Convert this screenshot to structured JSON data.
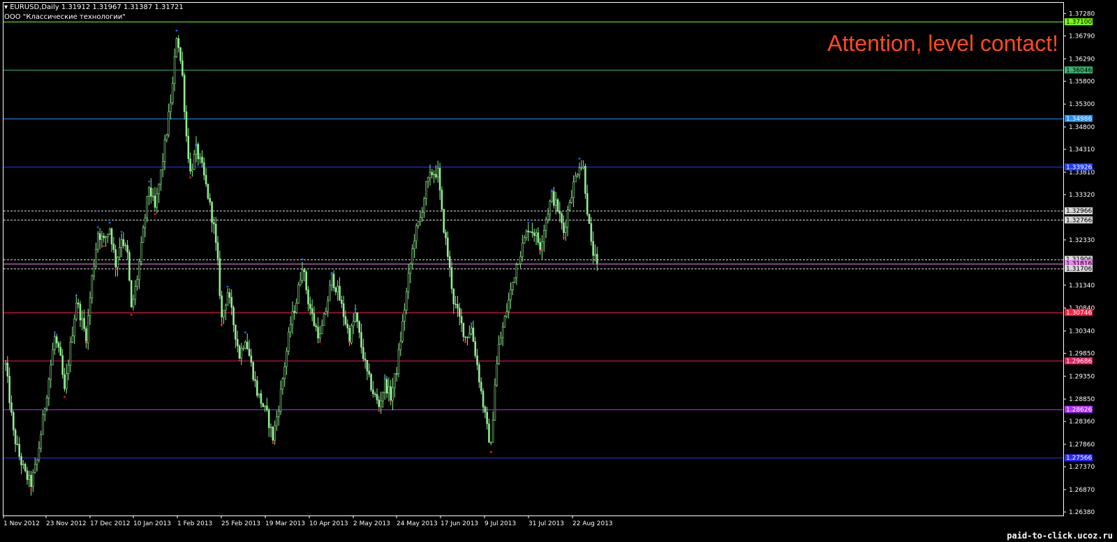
{
  "header": {
    "symbol_line": "EURUSD,Daily  1.31912 1.31967 1.31387 1.31721",
    "indicator_line": "ООО \"Классические технологии\""
  },
  "alert": {
    "text": "Attention, level contact!",
    "color": "#ff4a1a"
  },
  "watermark": "paid-to-click.ucoz.ru",
  "colors": {
    "background": "#000000",
    "candle": "#90ee90",
    "frame": "#ffffff"
  },
  "chart_data": {
    "type": "candlestick",
    "ylim": [
      1.2638,
      1.3753
    ],
    "y_ticks": [
      "1.37280",
      "1.36790",
      "1.36290",
      "1.35800",
      "1.35300",
      "1.34800",
      "1.34310",
      "1.33810",
      "1.33320",
      "1.32330",
      "1.31340",
      "1.30840",
      "1.30340",
      "1.29850",
      "1.29350",
      "1.28850",
      "1.28360",
      "1.27860",
      "1.27370",
      "1.26870",
      "1.26380"
    ],
    "x_labels": [
      "1 Nov 2012",
      "23 Nov 2012",
      "17 Dec 2012",
      "10 Jan 2013",
      "1 Feb 2013",
      "25 Feb 2013",
      "19 Mar 2013",
      "10 Apr 2013",
      "2 May 2013",
      "24 May 2013",
      "17 Jun 2013",
      "9 Jul 2013",
      "31 Jul 2013",
      "22 Aug 2013"
    ],
    "levels": [
      {
        "price": 1.371,
        "label": "1.37100",
        "color": "#7cfc00",
        "style": "solid"
      },
      {
        "price": 1.36046,
        "label": "1.36046",
        "color": "#3cb371",
        "style": "solid"
      },
      {
        "price": 1.34986,
        "label": "1.34986",
        "color": "#1e90ff",
        "style": "solid"
      },
      {
        "price": 1.33926,
        "label": "1.33926",
        "color": "#1f3cff",
        "style": "solid"
      },
      {
        "price": 1.32966,
        "label": "1.32966",
        "color": "#d9d9d9",
        "style": "dashed"
      },
      {
        "price": 1.32766,
        "label": "1.32766",
        "color": "#d9d9d9",
        "style": "dashed"
      },
      {
        "price": 1.31906,
        "label": "1.31906",
        "color": "#d9d9d9",
        "style": "dashed"
      },
      {
        "price": 1.31816,
        "label": "1.31816",
        "color": "#ee82ee",
        "style": "solid"
      },
      {
        "price": 1.31706,
        "label": "1.31706",
        "color": "#d9d9d9",
        "style": "dashed"
      },
      {
        "price": 1.30746,
        "label": "1.30746",
        "color": "#ff1a3c",
        "style": "solid"
      },
      {
        "price": 1.29686,
        "label": "1.29686",
        "color": "#e6195c",
        "style": "solid"
      },
      {
        "price": 1.28626,
        "label": "1.28626",
        "color": "#b02dff",
        "style": "solid"
      },
      {
        "price": 1.27566,
        "label": "1.27566",
        "color": "#2a2aff",
        "style": "solid"
      }
    ],
    "price_path": [
      [
        0,
        1.296
      ],
      [
        4,
        1.281
      ],
      [
        7,
        1.276
      ],
      [
        10,
        1.272
      ],
      [
        13,
        1.27
      ],
      [
        16,
        1.275
      ],
      [
        19,
        1.284
      ],
      [
        22,
        1.293
      ],
      [
        25,
        1.302
      ],
      [
        28,
        1.297
      ],
      [
        30,
        1.29
      ],
      [
        33,
        1.3
      ],
      [
        36,
        1.31
      ],
      [
        38,
        1.307
      ],
      [
        41,
        1.302
      ],
      [
        44,
        1.315
      ],
      [
        47,
        1.325
      ],
      [
        50,
        1.323
      ],
      [
        53,
        1.326
      ],
      [
        56,
        1.318
      ],
      [
        59,
        1.324
      ],
      [
        62,
        1.32
      ],
      [
        64,
        1.308
      ],
      [
        67,
        1.315
      ],
      [
        70,
        1.325
      ],
      [
        73,
        1.335
      ],
      [
        76,
        1.33
      ],
      [
        79,
        1.338
      ],
      [
        82,
        1.347
      ],
      [
        85,
        1.357
      ],
      [
        87,
        1.368
      ],
      [
        88,
        1.366
      ],
      [
        90,
        1.359
      ],
      [
        92,
        1.346
      ],
      [
        94,
        1.338
      ],
      [
        97,
        1.343
      ],
      [
        100,
        1.339
      ],
      [
        103,
        1.333
      ],
      [
        106,
        1.326
      ],
      [
        108,
        1.318
      ],
      [
        110,
        1.306
      ],
      [
        113,
        1.312
      ],
      [
        116,
        1.305
      ],
      [
        119,
        1.298
      ],
      [
        122,
        1.302
      ],
      [
        125,
        1.296
      ],
      [
        128,
        1.29
      ],
      [
        131,
        1.287
      ],
      [
        133,
        1.285
      ],
      [
        136,
        1.28
      ],
      [
        139,
        1.287
      ],
      [
        142,
        1.296
      ],
      [
        145,
        1.305
      ],
      [
        148,
        1.31
      ],
      [
        151,
        1.318
      ],
      [
        154,
        1.31
      ],
      [
        157,
        1.305
      ],
      [
        160,
        1.302
      ],
      [
        163,
        1.308
      ],
      [
        166,
        1.315
      ],
      [
        169,
        1.312
      ],
      [
        172,
        1.307
      ],
      [
        175,
        1.302
      ],
      [
        178,
        1.307
      ],
      [
        181,
        1.3
      ],
      [
        184,
        1.294
      ],
      [
        187,
        1.29
      ],
      [
        190,
        1.287
      ],
      [
        193,
        1.292
      ],
      [
        196,
        1.289
      ],
      [
        199,
        1.295
      ],
      [
        202,
        1.305
      ],
      [
        205,
        1.315
      ],
      [
        208,
        1.324
      ],
      [
        211,
        1.328
      ],
      [
        214,
        1.335
      ],
      [
        217,
        1.338
      ],
      [
        220,
        1.338
      ],
      [
        222,
        1.329
      ],
      [
        225,
        1.32
      ],
      [
        228,
        1.31
      ],
      [
        231,
        1.306
      ],
      [
        234,
        1.302
      ],
      [
        237,
        1.304
      ],
      [
        240,
        1.296
      ],
      [
        242,
        1.29
      ],
      [
        245,
        1.282
      ],
      [
        247,
        1.278
      ],
      [
        249,
        1.292
      ],
      [
        251,
        1.3
      ],
      [
        254,
        1.306
      ],
      [
        257,
        1.312
      ],
      [
        260,
        1.318
      ],
      [
        263,
        1.322
      ],
      [
        266,
        1.326
      ],
      [
        269,
        1.325
      ],
      [
        272,
        1.322
      ],
      [
        275,
        1.328
      ],
      [
        278,
        1.333
      ],
      [
        281,
        1.33
      ],
      [
        284,
        1.325
      ],
      [
        287,
        1.332
      ],
      [
        290,
        1.337
      ],
      [
        292,
        1.34
      ],
      [
        294,
        1.339
      ],
      [
        296,
        1.33
      ],
      [
        298,
        1.322
      ],
      [
        300,
        1.319
      ],
      [
        301,
        1.3172
      ]
    ],
    "candle_count": 302
  }
}
